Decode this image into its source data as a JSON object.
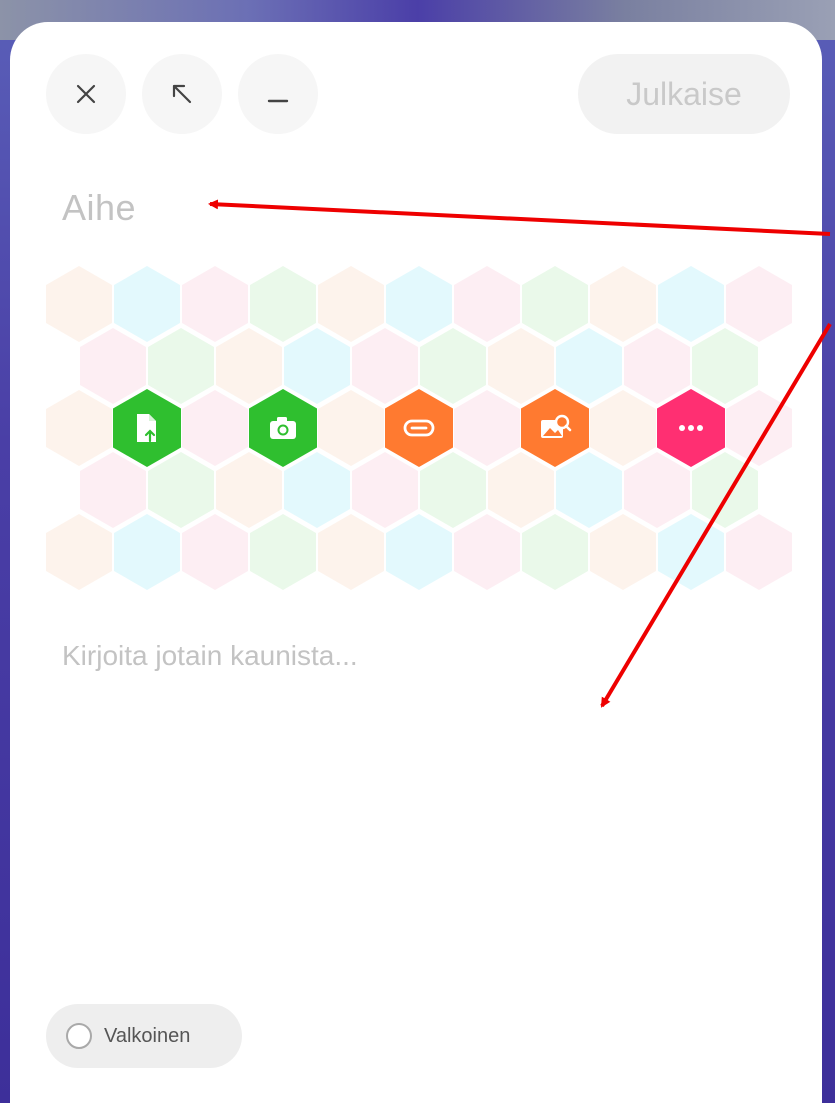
{
  "toolbar": {
    "close_icon": "close-icon",
    "expand_icon": "arrow-up-left-icon",
    "minimize_icon": "minimize-icon",
    "publish_label": "Julkaise"
  },
  "editor": {
    "subject_placeholder": "Aihe",
    "body_placeholder": "Kirjoita jotain kaunista..."
  },
  "attachments": [
    {
      "name": "file-upload",
      "icon": "file-upload-icon",
      "color": "#2fbf2f"
    },
    {
      "name": "camera",
      "icon": "camera-icon",
      "color": "#2fbf2f"
    },
    {
      "name": "link",
      "icon": "link-icon",
      "color": "#ff7a30"
    },
    {
      "name": "image-search",
      "icon": "image-search-icon",
      "color": "#ff7a30"
    },
    {
      "name": "more",
      "icon": "more-icon",
      "color": "#ff2f72"
    }
  ],
  "theme": {
    "label": "Valkoinen"
  },
  "annotation": {
    "arrow_color": "#ee0000"
  }
}
